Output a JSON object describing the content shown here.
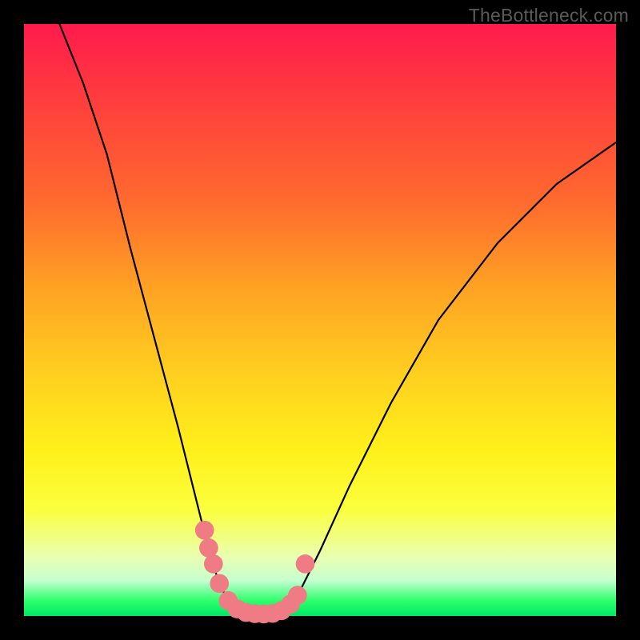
{
  "watermark": "TheBottleneck.com",
  "chart_data": {
    "type": "line",
    "title": "",
    "xlabel": "",
    "ylabel": "",
    "xlim": [
      0,
      100
    ],
    "ylim": [
      0,
      100
    ],
    "curves": {
      "left": {
        "description": "steep descending curve from top-left into valley",
        "points": [
          {
            "x": 6,
            "y": 100
          },
          {
            "x": 10,
            "y": 90
          },
          {
            "x": 14,
            "y": 78
          },
          {
            "x": 18,
            "y": 62
          },
          {
            "x": 22,
            "y": 47
          },
          {
            "x": 26,
            "y": 32
          },
          {
            "x": 28,
            "y": 24
          },
          {
            "x": 30,
            "y": 16
          },
          {
            "x": 31.5,
            "y": 10
          },
          {
            "x": 33,
            "y": 5.5
          },
          {
            "x": 34.5,
            "y": 2.5
          },
          {
            "x": 36,
            "y": 1
          },
          {
            "x": 37.5,
            "y": 0.4
          }
        ]
      },
      "valley": {
        "description": "flat minimum region",
        "points": [
          {
            "x": 37.5,
            "y": 0.4
          },
          {
            "x": 42,
            "y": 0.3
          },
          {
            "x": 44,
            "y": 0.6
          }
        ]
      },
      "right": {
        "description": "ascending curve from valley toward upper right",
        "points": [
          {
            "x": 44,
            "y": 0.6
          },
          {
            "x": 46,
            "y": 3
          },
          {
            "x": 50,
            "y": 11
          },
          {
            "x": 55,
            "y": 22
          },
          {
            "x": 62,
            "y": 36
          },
          {
            "x": 70,
            "y": 50
          },
          {
            "x": 80,
            "y": 63
          },
          {
            "x": 90,
            "y": 73
          },
          {
            "x": 100,
            "y": 80
          }
        ]
      }
    },
    "markers": {
      "color": "#ef7b85",
      "radius_pct": 1.6,
      "points": [
        {
          "x": 30.5,
          "y": 14.5
        },
        {
          "x": 31.2,
          "y": 11.5
        },
        {
          "x": 32.0,
          "y": 8.8
        },
        {
          "x": 33.0,
          "y": 5.5
        },
        {
          "x": 34.5,
          "y": 2.6
        },
        {
          "x": 36.0,
          "y": 1.2
        },
        {
          "x": 37.5,
          "y": 0.6
        },
        {
          "x": 39.0,
          "y": 0.4
        },
        {
          "x": 40.5,
          "y": 0.35
        },
        {
          "x": 42.0,
          "y": 0.45
        },
        {
          "x": 43.5,
          "y": 0.9
        },
        {
          "x": 45.0,
          "y": 2.0
        },
        {
          "x": 46.2,
          "y": 3.5
        },
        {
          "x": 47.5,
          "y": 8.8
        }
      ]
    }
  }
}
